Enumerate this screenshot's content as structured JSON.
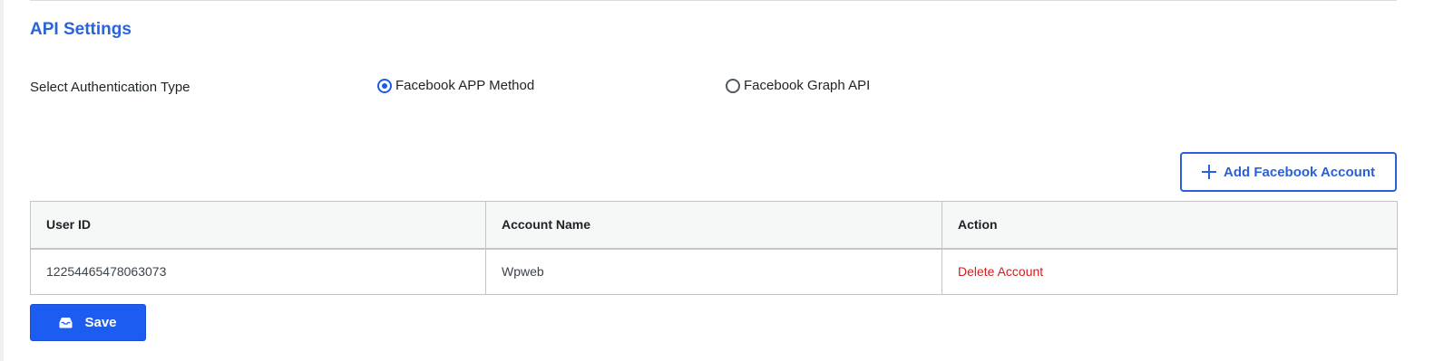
{
  "section": {
    "title": "API Settings"
  },
  "auth": {
    "label": "Select Authentication Type",
    "options": [
      {
        "label": "Facebook APP Method",
        "checked": true
      },
      {
        "label": "Facebook Graph API",
        "checked": false
      }
    ]
  },
  "actions": {
    "add_account_label": "Add Facebook Account",
    "save_label": "Save"
  },
  "table": {
    "headers": [
      "User ID",
      "Account Name",
      "Action"
    ],
    "rows": [
      {
        "user_id": "12254465478063073",
        "account_name": "Wpweb",
        "action": "Delete Account"
      }
    ]
  },
  "icons": {
    "add": "plus-icon",
    "save": "inbox-icon"
  },
  "colors": {
    "accent": "#1d5cf0",
    "title": "#2b63d9",
    "danger": "#d11e1e"
  }
}
